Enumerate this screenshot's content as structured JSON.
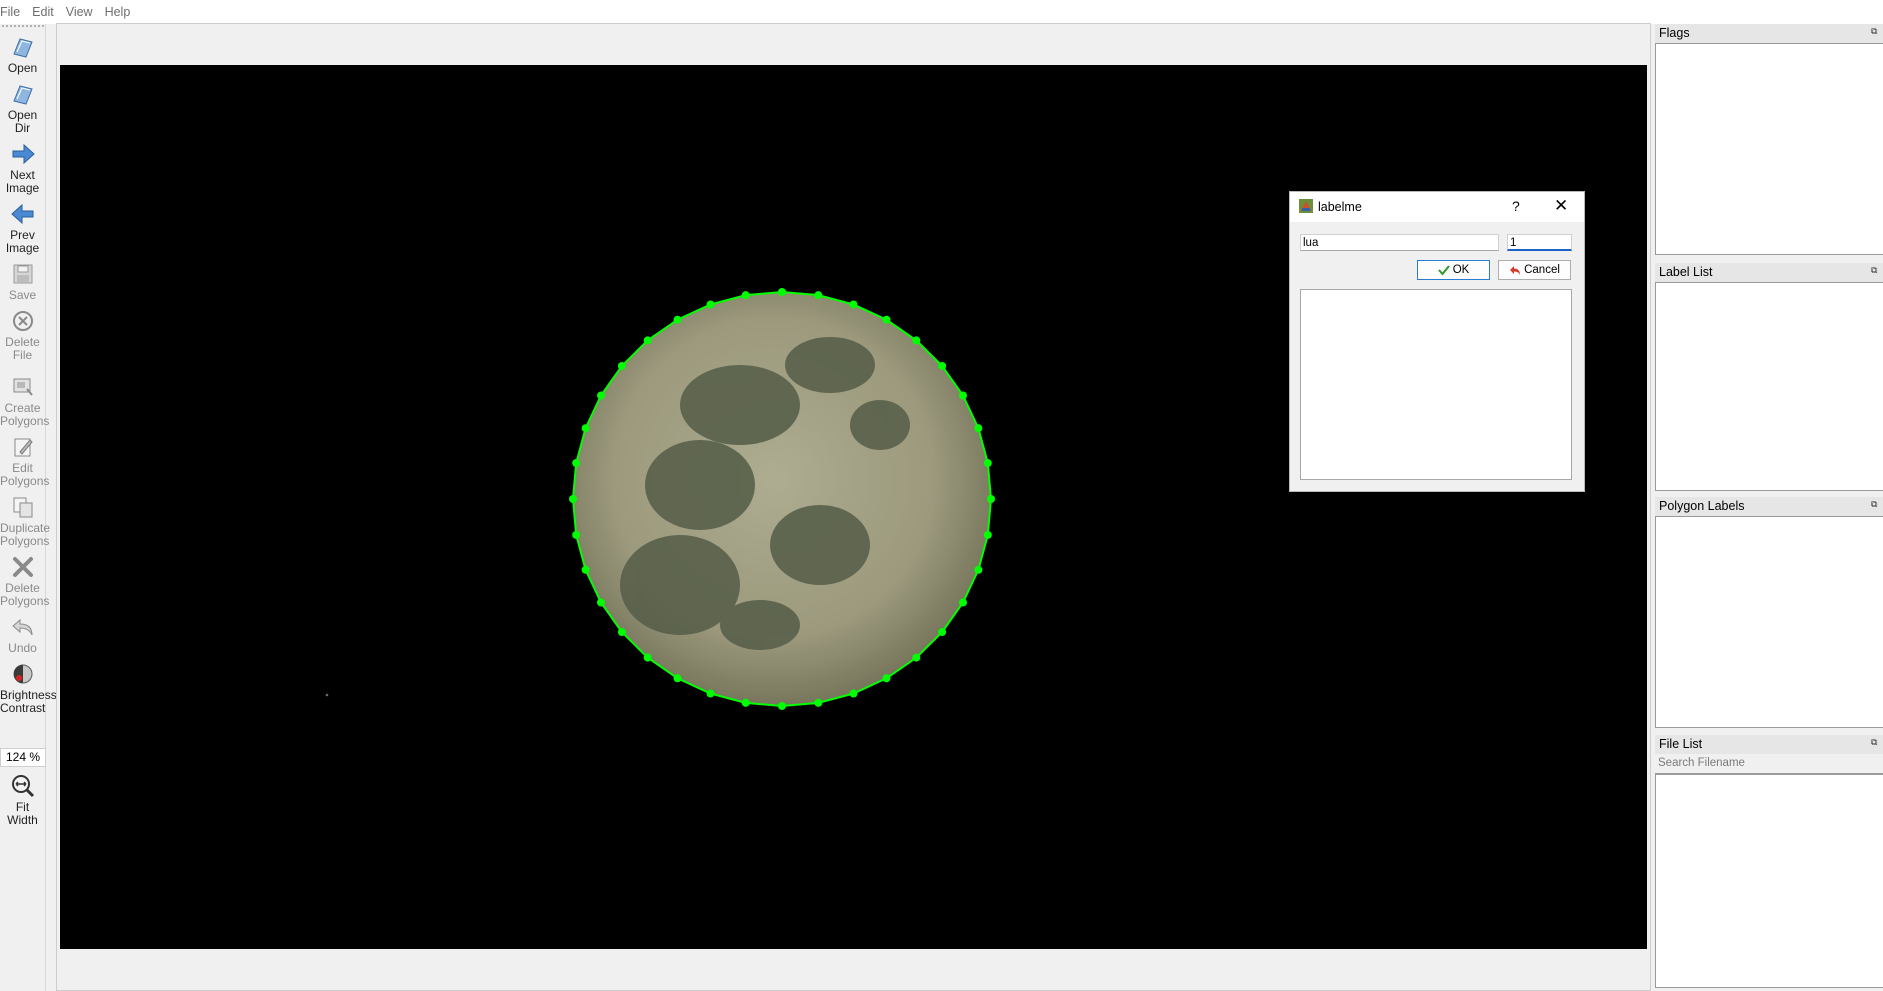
{
  "menu": {
    "items": [
      {
        "label": "File"
      },
      {
        "label": "Edit"
      },
      {
        "label": "View"
      },
      {
        "label": "Help"
      }
    ]
  },
  "toolbar": {
    "tools": [
      {
        "label": "Open",
        "icon": "open-icon",
        "enabled": true
      },
      {
        "label": "Open\nDir",
        "icon": "open-dir-icon",
        "enabled": true
      },
      {
        "label": "Next\nImage",
        "icon": "next-arrow-icon",
        "enabled": true
      },
      {
        "label": "Prev\nImage",
        "icon": "prev-arrow-icon",
        "enabled": true
      },
      {
        "label": "Save",
        "icon": "save-icon",
        "enabled": false
      },
      {
        "label": "Delete\nFile",
        "icon": "delete-file-icon",
        "enabled": false
      },
      {
        "label": "Create\nPolygons",
        "icon": "create-polygons-icon",
        "enabled": false
      },
      {
        "label": "Edit\nPolygons",
        "icon": "edit-polygons-icon",
        "enabled": false
      },
      {
        "label": "Duplicate\nPolygons",
        "icon": "duplicate-polygons-icon",
        "enabled": false
      },
      {
        "label": "Delete\nPolygons",
        "icon": "delete-polygons-icon",
        "enabled": false
      },
      {
        "label": "Undo",
        "icon": "undo-icon",
        "enabled": false
      },
      {
        "label": "Brightness\nContrast",
        "icon": "brightness-contrast-icon",
        "enabled": true
      }
    ],
    "zoom": "124 %",
    "fit_width": {
      "label": "Fit\nWidth",
      "icon": "fit-width-icon"
    }
  },
  "docks": {
    "flags": {
      "title": "Flags"
    },
    "label_list": {
      "title": "Label List"
    },
    "polygon_labels": {
      "title": "Polygon Labels"
    },
    "file_list": {
      "title": "File List",
      "search_placeholder": "Search Filename"
    }
  },
  "dialog": {
    "title": "labelme",
    "help": "?",
    "close": "✕",
    "label_value": "lua",
    "group_value": "1",
    "ok_label": "OK",
    "cancel_label": "Cancel"
  },
  "colors": {
    "polygon_line": "#00ff00",
    "polygon_point": "#00ff00",
    "accent": "#1e64c8"
  }
}
